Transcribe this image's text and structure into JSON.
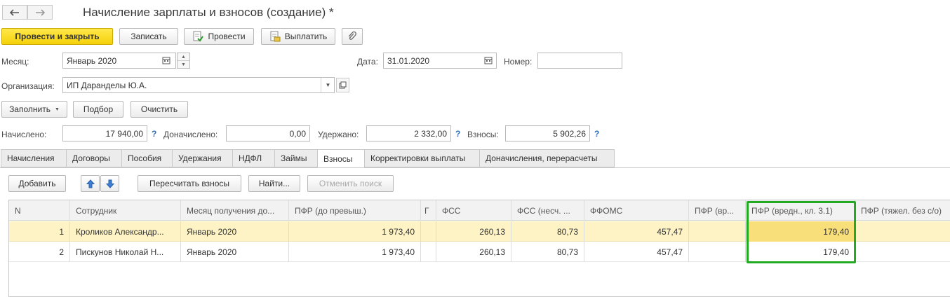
{
  "window": {
    "title": "Начисление зарплаты и взносов (создание) *",
    "back_icon": "arrow-left-icon",
    "forward_icon": "arrow-right-icon"
  },
  "toolbar": {
    "post_and_close": "Провести и закрыть",
    "save": "Записать",
    "post": "Провести",
    "pay": "Выплатить",
    "attach_icon": "paperclip-icon"
  },
  "header": {
    "month_label": "Месяц:",
    "month_value": "Январь 2020",
    "date_label": "Дата:",
    "date_value": "31.01.2020",
    "number_label": "Номер:",
    "number_value": "",
    "org_label": "Организация:",
    "org_value": "ИП Даранделы Ю.А."
  },
  "actions": {
    "fill": "Заполнить",
    "select": "Подбор",
    "clear": "Очистить"
  },
  "totals": {
    "accrued_label": "Начислено:",
    "accrued_value": "17 940,00",
    "additional_label": "Доначислено:",
    "additional_value": "0,00",
    "withheld_label": "Удержано:",
    "withheld_value": "2 332,00",
    "contrib_label": "Взносы:",
    "contrib_value": "5 902,26",
    "help": "?"
  },
  "tabs": [
    "Начисления",
    "Договоры",
    "Пособия",
    "Удержания",
    "НДФЛ",
    "Займы",
    "Взносы",
    "Корректировки выплаты",
    "Доначисления, перерасчеты"
  ],
  "active_tab": "Взносы",
  "table_toolbar": {
    "add": "Добавить",
    "recalc": "Пересчитать взносы",
    "find": "Найти...",
    "cancel_search": "Отменить поиск"
  },
  "table": {
    "columns": [
      "N",
      "Сотрудник",
      "Месяц получения до...",
      "ПФР (до превыш.)",
      "Г",
      "ФСС",
      "ФСС (несч. ...",
      "ФФОМС",
      "ПФР (вр...",
      "ПФР (вредн.,  кл. 3.1)",
      "ПФР (тяжел. без с/о)"
    ],
    "rows": [
      [
        "1",
        "Кроликов Александр...",
        "Январь 2020",
        "1 973,40",
        "",
        "260,13",
        "80,73",
        "457,47",
        "",
        "179,40",
        ""
      ],
      [
        "2",
        "Пискунов Николай Н...",
        "Январь 2020",
        "1 973,40",
        "",
        "260,13",
        "80,73",
        "457,47",
        "",
        "179,40",
        ""
      ]
    ]
  },
  "colors": {
    "primary_button": "#f5d209",
    "selected_row": "#fdf3c4",
    "highlight_frame": "#22aa22",
    "help_mark": "#2d6fb7"
  }
}
